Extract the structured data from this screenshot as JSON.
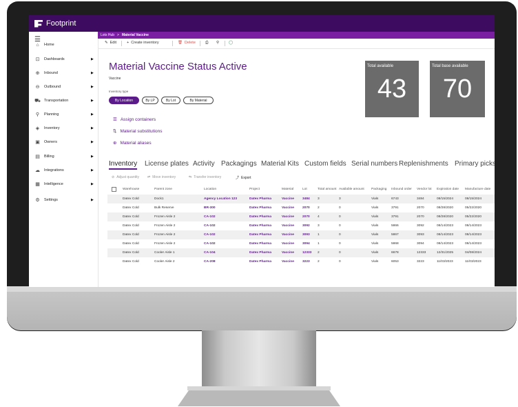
{
  "app": {
    "name": "Footprint"
  },
  "sidebar": {
    "items": [
      {
        "label": "Home",
        "icon": "home-icon",
        "glyph": "⌂",
        "arrow": false
      },
      {
        "label": "Dashboards",
        "icon": "dashboards-icon",
        "glyph": "⊡",
        "arrow": true
      },
      {
        "label": "Inbound",
        "icon": "inbound-icon",
        "glyph": "⊕",
        "arrow": true
      },
      {
        "label": "Outbound",
        "icon": "outbound-icon",
        "glyph": "⊖",
        "arrow": true
      },
      {
        "label": "Transportation",
        "icon": "truck-icon",
        "glyph": "⛟",
        "arrow": true
      },
      {
        "label": "Planning",
        "icon": "planning-icon",
        "glyph": "⚲",
        "arrow": true
      },
      {
        "label": "Inventory",
        "icon": "inventory-icon",
        "glyph": "◈",
        "arrow": true
      },
      {
        "label": "Owners",
        "icon": "owners-icon",
        "glyph": "▣",
        "arrow": true
      },
      {
        "label": "Billing",
        "icon": "billing-icon",
        "glyph": "▤",
        "arrow": true
      },
      {
        "label": "Integrations",
        "icon": "integrations-icon",
        "glyph": "☁",
        "arrow": true
      },
      {
        "label": "Intelligence",
        "icon": "intelligence-icon",
        "glyph": "▦",
        "arrow": true
      },
      {
        "label": "Settings",
        "icon": "gear-icon",
        "glyph": "⚙",
        "arrow": true
      }
    ]
  },
  "breadcrumb": {
    "parent": "Lots Hub",
    "separator": ">",
    "current": "Material Vaccine"
  },
  "toolbar": {
    "edit": "Edit",
    "create_inventory": "Create inventory",
    "delete": "Delete"
  },
  "page": {
    "title": "Material Vaccine Status Active",
    "subtitle": "Vaccine",
    "inventory_type_label": "Inventory type",
    "inventory_types": [
      "By Location",
      "By LP",
      "By Lot",
      "By Material"
    ],
    "links": [
      "Assign containers",
      "Material substitutions",
      "Material aliases"
    ]
  },
  "cards": [
    {
      "label": "Total available",
      "value": "43"
    },
    {
      "label": "Total base available",
      "value": "70"
    }
  ],
  "tabs": [
    "Inventory",
    "License plates",
    "Activity",
    "Packagings",
    "Material Kits",
    "Custom fields",
    "Serial numbers",
    "Replenishments",
    "Primary picks"
  ],
  "grid_actions": [
    "Adjust quantity",
    "Move inventory",
    "Transfer inventory",
    "Export"
  ],
  "table": {
    "headers": [
      "Warehouse",
      "Parent zone",
      "Location",
      "Project",
      "Material",
      "Lot",
      "Total amount",
      "Available amount",
      "Packaging",
      "Inbound order",
      "Vendor lot",
      "Expiration date",
      "Manufacture date"
    ],
    "rows": [
      [
        "Datex Cold",
        "Dock1",
        "Agency Location 123",
        "Datex Pharma",
        "Vaccine",
        "3484",
        "3",
        "3",
        "Vials",
        "6743",
        "3484",
        "08/15/2024",
        "08/15/2024"
      ],
      [
        "Datex Cold",
        "Bulk Reserve",
        "BR-300",
        "Datex Pharma",
        "Vaccine",
        "2070",
        "2",
        "0",
        "Vials",
        "3791",
        "2070",
        "08/28/2020",
        "05/22/2020"
      ],
      [
        "Datex Cold",
        "Frozen Aisle 2",
        "CA-102",
        "Datex Pharma",
        "Vaccine",
        "2070",
        "4",
        "0",
        "Vials",
        "3791",
        "2070",
        "08/28/2020",
        "05/22/2020"
      ],
      [
        "Datex Cold",
        "Frozen Aisle 2",
        "CA-102",
        "Datex Pharma",
        "Vaccine",
        "3092",
        "3",
        "0",
        "Vials",
        "5866",
        "3092",
        "08/14/2023",
        "08/14/2023"
      ],
      [
        "Datex Cold",
        "Frozen Aisle 2",
        "CA-102",
        "Datex Pharma",
        "Vaccine",
        "3093",
        "1",
        "0",
        "Vials",
        "5867",
        "3093",
        "08/14/2023",
        "08/14/2023"
      ],
      [
        "Datex Cold",
        "Frozen Aisle 2",
        "CA-102",
        "Datex Pharma",
        "Vaccine",
        "3094",
        "1",
        "0",
        "Vials",
        "5868",
        "3094",
        "08/14/2023",
        "08/14/2023"
      ],
      [
        "Datex Cold",
        "Cooler Aisle 1",
        "CA-104",
        "Datex Pharma",
        "Vaccine",
        "12333",
        "2",
        "0",
        "Vials",
        "6678",
        "12333",
        "12/31/2025",
        "04/08/2024"
      ],
      [
        "Datex Cold",
        "Cooler Aisle 2",
        "CA-208",
        "Datex Pharma",
        "Vaccine",
        "3223",
        "2",
        "0",
        "Vials",
        "6053",
        "3223",
        "11/03/2023",
        "11/03/2023"
      ]
    ]
  },
  "colors": {
    "topbar": "#3d0b60",
    "accent": "#5c1b8a",
    "breadcrumb_bar": "#7a1fa2",
    "card": "#6b6b6b"
  }
}
